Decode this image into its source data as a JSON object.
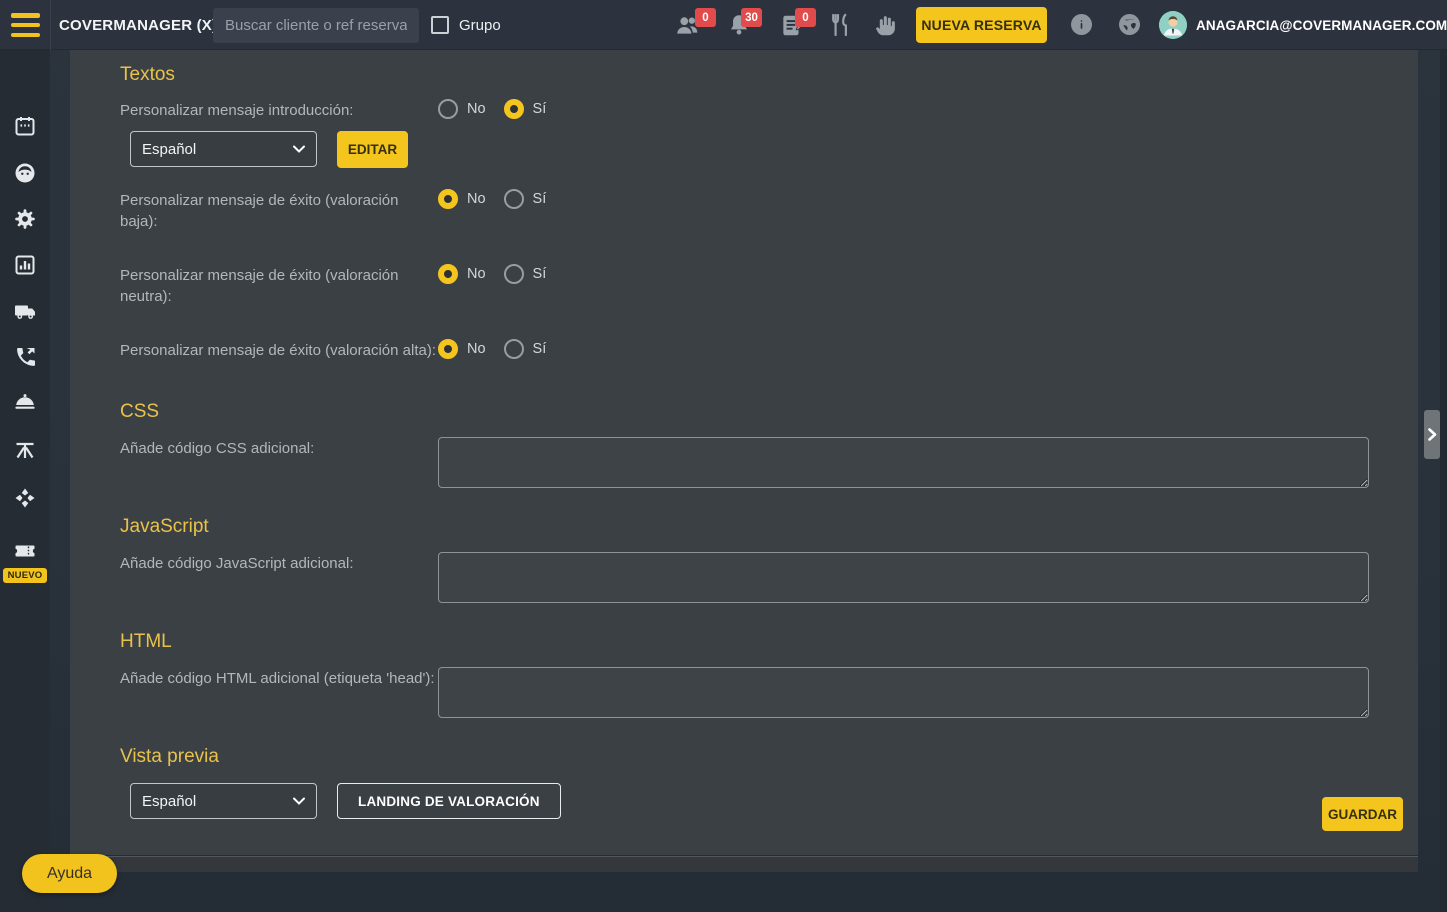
{
  "topbar": {
    "brand": "COVERMANAGER (X)",
    "search_placeholder": "Buscar cliente o ref reserva",
    "grupo_label": "Grupo",
    "badges": {
      "clients": "0",
      "notifications": "30",
      "reservations": "0"
    },
    "new_reservation_label": "NUEVA RESERVA",
    "account_email": "ANAGARCIA@COVERMANAGER.COM"
  },
  "sidebar": {
    "nuevo_badge": "NUEVO"
  },
  "content": {
    "textos": {
      "title": "Textos",
      "radio_no": "No",
      "radio_si": "Sí",
      "rows": [
        {
          "label": "Personalizar mensaje introducción:",
          "selected": "si"
        },
        {
          "label": "Personalizar mensaje de éxito (valoración baja):",
          "selected": "no"
        },
        {
          "label": "Personalizar mensaje de éxito (valoración neutra):",
          "selected": "no"
        },
        {
          "label": "Personalizar mensaje de éxito (valoración alta):",
          "selected": "no"
        }
      ],
      "language_select": "Español",
      "edit_button": "EDITAR"
    },
    "css": {
      "title": "CSS",
      "label": "Añade código CSS adicional:",
      "value": ""
    },
    "javascript": {
      "title": "JavaScript",
      "label": "Añade código JavaScript adicional:",
      "value": ""
    },
    "html": {
      "title": "HTML",
      "label": "Añade código HTML adicional (etiqueta 'head'):",
      "value": ""
    },
    "vista_previa": {
      "title": "Vista previa",
      "language_select": "Español",
      "landing_button": "LANDING DE VALORACIÓN"
    },
    "save_button": "GUARDAR"
  },
  "help_button": "Ayuda",
  "colors": {
    "accent_yellow": "#f4c51d",
    "badge_red": "#e14b4b",
    "panel_bg": "#3b4045",
    "topbar_bg": "#2d333e"
  }
}
